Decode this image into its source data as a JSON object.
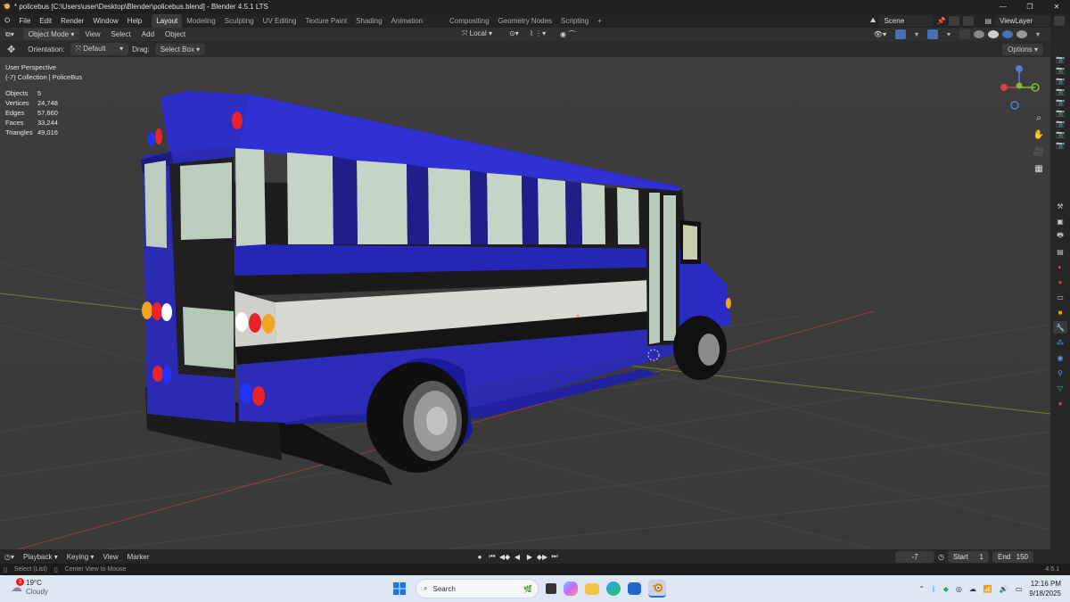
{
  "window": {
    "title": "* policebus [C:\\Users\\user\\Desktop\\Blender\\policebus.blend] - Blender 4.5.1 LTS",
    "controls": [
      "minimize-icon",
      "maximize-icon",
      "close-icon"
    ]
  },
  "menu": [
    "File",
    "Edit",
    "Render",
    "Window",
    "Help"
  ],
  "workspaces": {
    "active": "Layout",
    "items": [
      "Layout",
      "Modeling",
      "Sculpting",
      "UV Editing",
      "Texture Paint",
      "Shading",
      "Animation",
      "Compositing",
      "Geometry Nodes",
      "Scripting"
    ]
  },
  "scene": {
    "scene_name": "Scene",
    "view_layer": "ViewLayer"
  },
  "viewport_header": {
    "mode": "Object Mode",
    "menus": [
      "View",
      "Select",
      "Add",
      "Object"
    ],
    "transform_orientation": "Local"
  },
  "tool_options": {
    "orientation_label": "Orientation:",
    "orientation_value": "Default",
    "drag_label": "Drag:",
    "drag_value": "Select Box",
    "options_label": "Options"
  },
  "overlay_text": {
    "view": "User Perspective",
    "collection": "(-7) Collection | PoliceBus"
  },
  "stats": [
    {
      "label": "Objects",
      "value": "5"
    },
    {
      "label": "Vertices",
      "value": "24,748"
    },
    {
      "label": "Edges",
      "value": "57,660"
    },
    {
      "label": "Faces",
      "value": "33,244"
    },
    {
      "label": "Triangles",
      "value": "49,016"
    }
  ],
  "gizmo_axes": {
    "x": "X",
    "y": "Y",
    "z": "Z"
  },
  "timeline": {
    "menus": [
      "Playback",
      "Keying",
      "View",
      "Marker"
    ],
    "current_frame": "-7",
    "start_label": "Start",
    "start_value": "1",
    "end_label": "End",
    "end_value": "150"
  },
  "statusbar": {
    "hint1": "Select (List)",
    "hint2": "Center View to Mouse",
    "version": "4.5.1"
  },
  "taskbar": {
    "weather_badge": "3",
    "temperature": "19°C",
    "condition": "Cloudy",
    "search_placeholder": "Search",
    "time": "12:16 PM",
    "date": "9/18/2025"
  },
  "colors": {
    "bus_body": "#2d2dc0",
    "bus_roof": "#2e2ed0",
    "stripe": "#d9d9d4",
    "window_glass": "#bcd0c2",
    "viewport_bg": "#3b3b3b",
    "accent": "#4772b3",
    "taskbar": "#dfe7f4"
  }
}
